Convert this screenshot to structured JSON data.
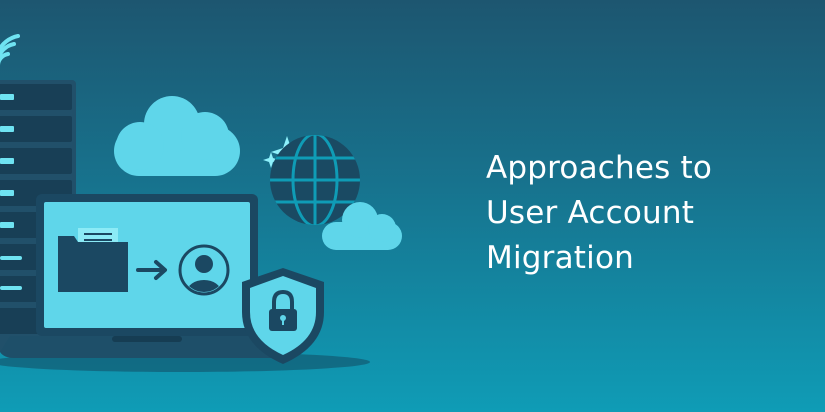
{
  "headline": {
    "lines": [
      "Approaches to",
      "User Account",
      "Migration"
    ]
  },
  "illustration": {
    "icons": [
      "wifi-icon",
      "server-rack-icon",
      "cloud-icon",
      "sparkle-icon",
      "globe-icon",
      "laptop-icon",
      "folder-icon",
      "arrow-right-icon",
      "user-avatar-icon",
      "shield-lock-icon"
    ]
  },
  "colors": {
    "background_top": "#1d5670",
    "background_bottom": "#0f9cb6",
    "accent_cyan": "#5fd6ea",
    "dark_navy": "#16384f",
    "text": "#ffffff"
  }
}
